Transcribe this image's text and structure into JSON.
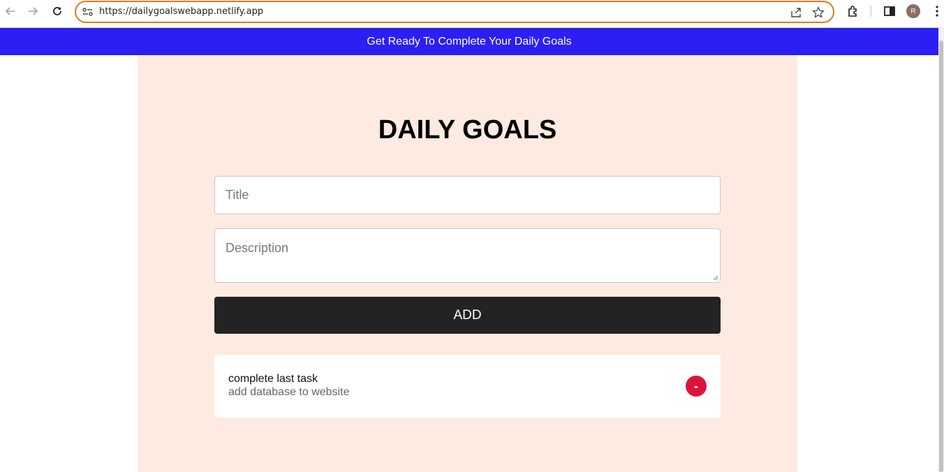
{
  "browser": {
    "url": "https://dailygoalswebapp.netlify.app",
    "profile_initial": "R"
  },
  "banner": {
    "text": "Get Ready To Complete Your Daily Goals",
    "color": "#2b1ff2"
  },
  "app": {
    "heading": "DAILY GOALS",
    "title_placeholder": "Title",
    "description_placeholder": "Description",
    "add_label": "ADD",
    "panel_color": "#fdebe1"
  },
  "goals": [
    {
      "title": "complete last task",
      "description": "add database to website",
      "remove_label": "-",
      "remove_color": "#dc143c"
    }
  ]
}
